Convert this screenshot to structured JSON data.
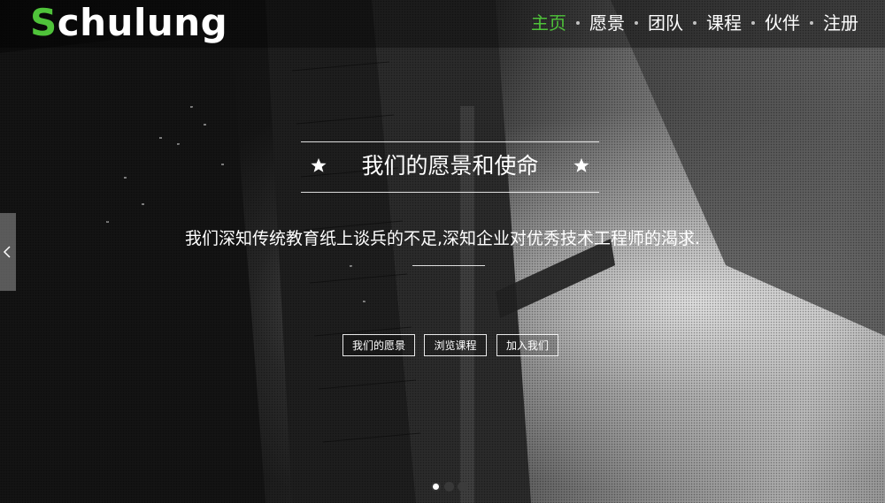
{
  "header": {
    "logo_first_letter": "S",
    "logo_rest": "chulung",
    "nav": [
      {
        "label": "主页",
        "active": true
      },
      {
        "label": "愿景",
        "active": false
      },
      {
        "label": "团队",
        "active": false
      },
      {
        "label": "课程",
        "active": false
      },
      {
        "label": "伙伴",
        "active": false
      },
      {
        "label": "注册",
        "active": false
      }
    ]
  },
  "hero": {
    "title": "我们的愿景和使命",
    "subtitle": "我们深知传统教育纸上谈兵的不足,深知企业对优秀技术工程师的渴求.",
    "buttons": [
      {
        "label": "我们的愿景"
      },
      {
        "label": "浏览课程"
      },
      {
        "label": "加入我们"
      }
    ],
    "slide_count": 3,
    "active_slide": 1
  },
  "icons": {
    "title_decoration": "star-icon",
    "prev": "chevron-left-icon"
  },
  "colors": {
    "accent": "#4fc33a",
    "text": "#ffffff"
  }
}
